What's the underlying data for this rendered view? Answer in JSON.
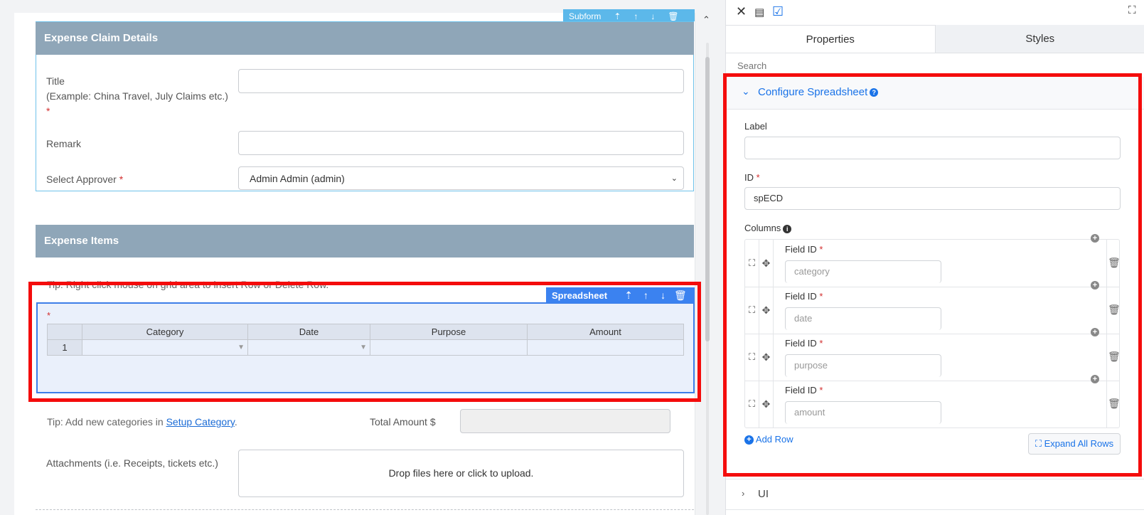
{
  "form": {
    "subform_toolbar": {
      "label": "Subform"
    },
    "section1": {
      "title": "Expense Claim Details"
    },
    "title_field": {
      "label_line1": "Title",
      "label_line2": "(Example: China Travel, July Claims etc.)",
      "required": "*",
      "value": ""
    },
    "remark_field": {
      "label": "Remark",
      "value": ""
    },
    "approver_field": {
      "label": "Select Approver",
      "required": "*",
      "value": "Admin Admin (admin)"
    },
    "section2": {
      "title": "Expense Items"
    },
    "tip1": "Tip: Right click mouse on grid area to insert Row or Delete Row.",
    "spreadsheet_toolbar": {
      "label": "Spreadsheet"
    },
    "spreadsheet": {
      "required": "*",
      "columns": [
        "Category",
        "Date",
        "Purpose",
        "Amount"
      ],
      "rows": [
        {
          "number": "1",
          "cells": [
            "",
            "",
            "",
            ""
          ]
        }
      ]
    },
    "tip2": {
      "prefix": "Tip: Add new categories in ",
      "link": "Setup Category",
      "suffix": "."
    },
    "total": {
      "label": "Total Amount $",
      "value": ""
    },
    "attachments": {
      "label": "Attachments (i.e. Receipts, tickets etc.)",
      "dropzone": "Drop files here or click to upload."
    }
  },
  "panel": {
    "icons": [
      "close-icon",
      "form-icon",
      "checkbox-icon",
      "fullscreen-icon"
    ],
    "tabs": [
      {
        "label": "Properties",
        "active": true
      },
      {
        "label": "Styles",
        "active": false
      }
    ],
    "search_placeholder": "Search",
    "section_title": "Configure Spreadsheet",
    "label_field": {
      "label": "Label",
      "value": ""
    },
    "id_field": {
      "label": "ID",
      "required": "*",
      "value": "spECD"
    },
    "columns_label": "Columns",
    "columns": [
      {
        "field_label": "Field ID",
        "required": "*",
        "placeholder": "category"
      },
      {
        "field_label": "Field ID",
        "required": "*",
        "placeholder": "date"
      },
      {
        "field_label": "Field ID",
        "required": "*",
        "placeholder": "purpose"
      },
      {
        "field_label": "Field ID",
        "required": "*",
        "placeholder": "amount"
      }
    ],
    "add_row": "Add Row",
    "expand_all_rows": "Expand All Rows",
    "ui_section": "UI"
  },
  "colors": {
    "accent": "#1a73e8",
    "section_header": "#8fa6b8",
    "highlight": "#f40c0c",
    "spreadsheet_toolbar": "#3b82f0"
  }
}
